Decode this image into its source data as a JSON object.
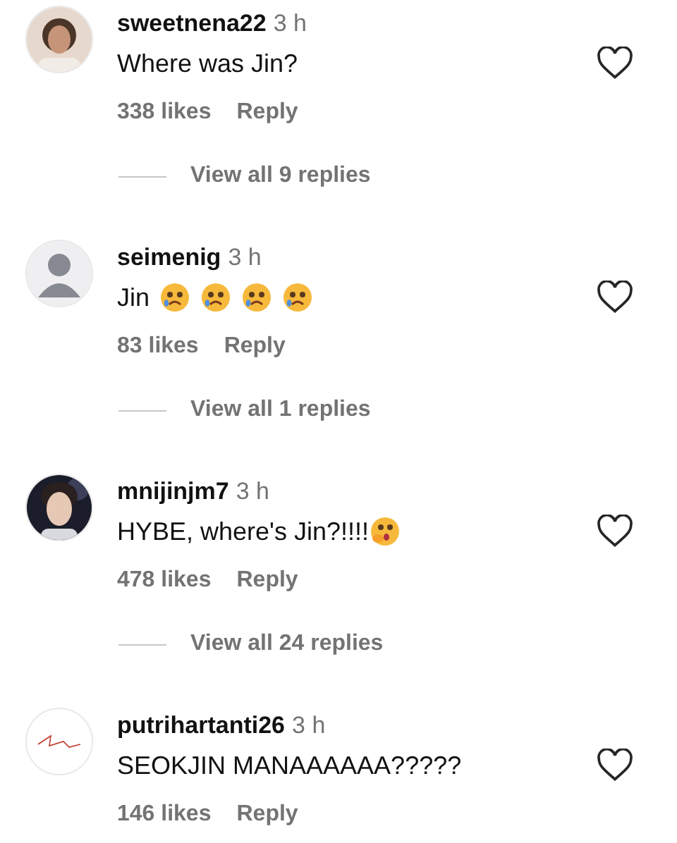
{
  "comments": [
    {
      "username": "sweetnena22",
      "time": "3 h",
      "text": "Where was Jin?",
      "likes": "338 likes",
      "reply": "Reply",
      "view_replies": "View all 9 replies"
    },
    {
      "avatar": {
        "kind": "silhouette"
      },
      "username": "seimenig",
      "time": "3 h",
      "text": "Jin",
      "emoji": [
        {
          "kind": "crying"
        },
        {
          "kind": "crying"
        },
        {
          "kind": "crying"
        },
        {
          "kind": "crying"
        }
      ],
      "likes": "83 likes",
      "reply": "Reply",
      "view_replies": "View all 1 replies"
    },
    {
      "username": "mnijinjm7",
      "time": "3 h",
      "text": "HYBE, where's Jin?!!!!",
      "emoji": [
        {
          "kind": "gasp"
        }
      ],
      "likes": "478 likes",
      "reply": "Reply",
      "view_replies": "View all 24 replies"
    },
    {
      "avatar": {
        "kind": "sketch"
      },
      "username": "putrihartanti26",
      "time": "3 h",
      "text": "SEOKJIN MANAAAAAA?????",
      "likes": "146 likes",
      "reply": "Reply"
    }
  ]
}
